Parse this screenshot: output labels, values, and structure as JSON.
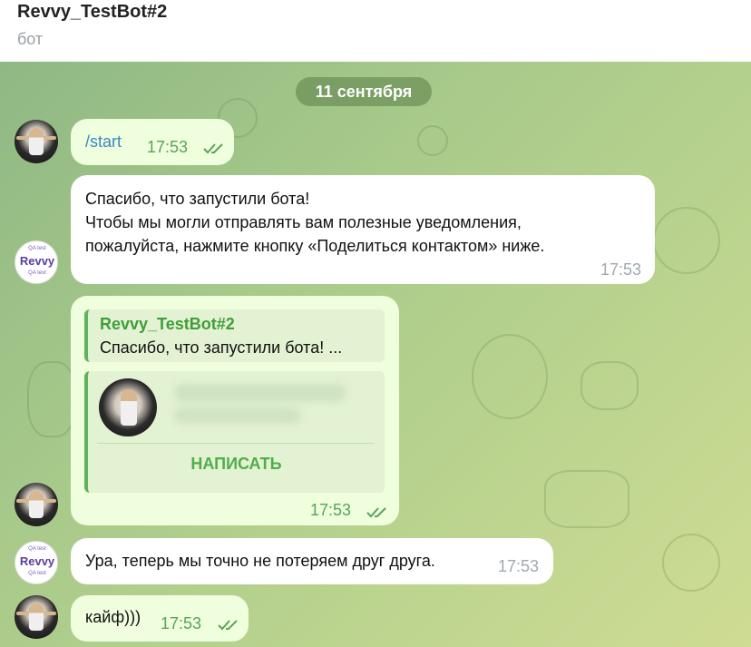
{
  "header": {
    "title": "Revvy_TestBot#2",
    "subtitle": "бот"
  },
  "chat": {
    "date": "11 сентября",
    "messages": [
      {
        "text": "/start",
        "time": "17:53"
      },
      {
        "line1": "Спасибо, что запустили бота!",
        "line2": "Чтобы мы могли отправлять вам полезные уведомления,",
        "line3": "пожалуйста, нажмите кнопку «Поделиться контактом» ниже.",
        "time": "17:53"
      },
      {
        "reply_name": "Revvy_TestBot#2",
        "reply_text": "Спасибо, что запустили бота!   ...",
        "button": "НАПИСАТЬ",
        "time": "17:53"
      },
      {
        "text": "Ура, теперь мы точно не потеряем друг друга.",
        "time": "17:53"
      },
      {
        "text": "кайф)))",
        "time": "17:53"
      }
    ]
  },
  "avatars": {
    "bot_word": "Revvy",
    "bot_small_top": "QA test",
    "bot_small_bottom": "QA test"
  },
  "colors": {
    "outgoing": "#effedd",
    "incoming": "#ffffff",
    "accent": "#4fae4a",
    "link": "#3a86c8"
  }
}
